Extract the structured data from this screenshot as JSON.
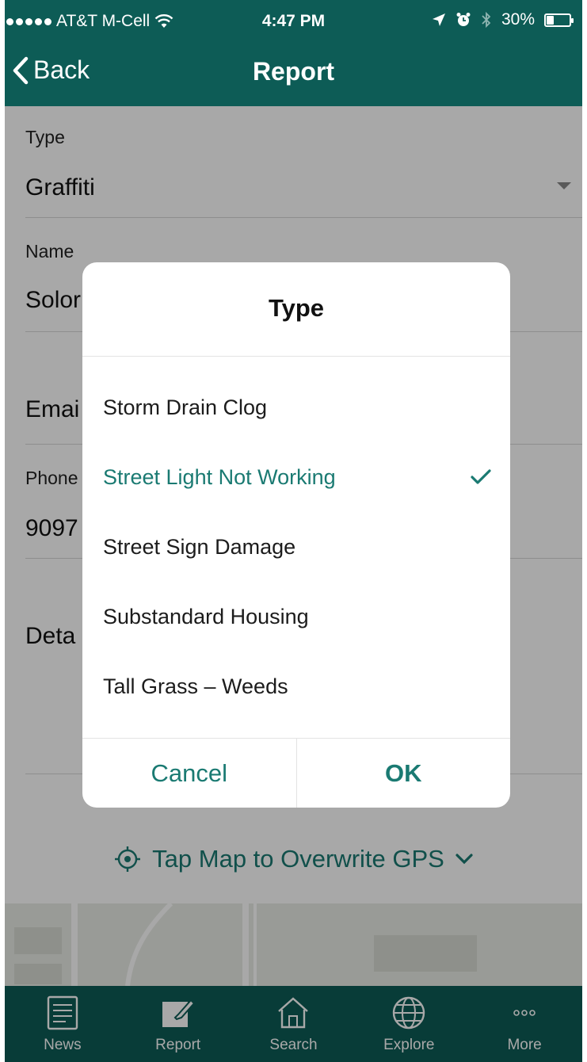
{
  "status_bar": {
    "carrier": "AT&T M-Cell",
    "time": "4:47 PM",
    "battery": "30%",
    "battery_level": 0.3,
    "icons": [
      "wifi-icon",
      "location-arrow-icon",
      "alarm-icon",
      "bluetooth-icon",
      "battery-icon"
    ]
  },
  "nav": {
    "back_label": "Back",
    "title": "Report"
  },
  "form": {
    "type_label": "Type",
    "type_value": "Graffiti",
    "name_label": "Name",
    "name_value": "Solor",
    "email_label": "Emai",
    "phone_label": "Phone",
    "phone_value": "9097",
    "details_label": "Deta",
    "gps_label": "Tap Map to Overwrite GPS"
  },
  "dialog": {
    "title": "Type",
    "options": [
      {
        "label": "Storm Drain Clog",
        "selected": false
      },
      {
        "label": "Street Light Not Working",
        "selected": true
      },
      {
        "label": "Street Sign Damage",
        "selected": false
      },
      {
        "label": "Substandard Housing",
        "selected": false
      },
      {
        "label": "Tall Grass – Weeds",
        "selected": false
      }
    ],
    "cancel_label": "Cancel",
    "ok_label": "OK"
  },
  "tabs": [
    {
      "label": "News",
      "icon": "news-icon"
    },
    {
      "label": "Report",
      "icon": "report-icon",
      "active": true
    },
    {
      "label": "Search",
      "icon": "home-search-icon"
    },
    {
      "label": "Explore",
      "icon": "globe-icon"
    },
    {
      "label": "More",
      "icon": "more-icon"
    }
  ],
  "colors": {
    "brand": "#0d5c56",
    "accent": "#1a7a72"
  }
}
